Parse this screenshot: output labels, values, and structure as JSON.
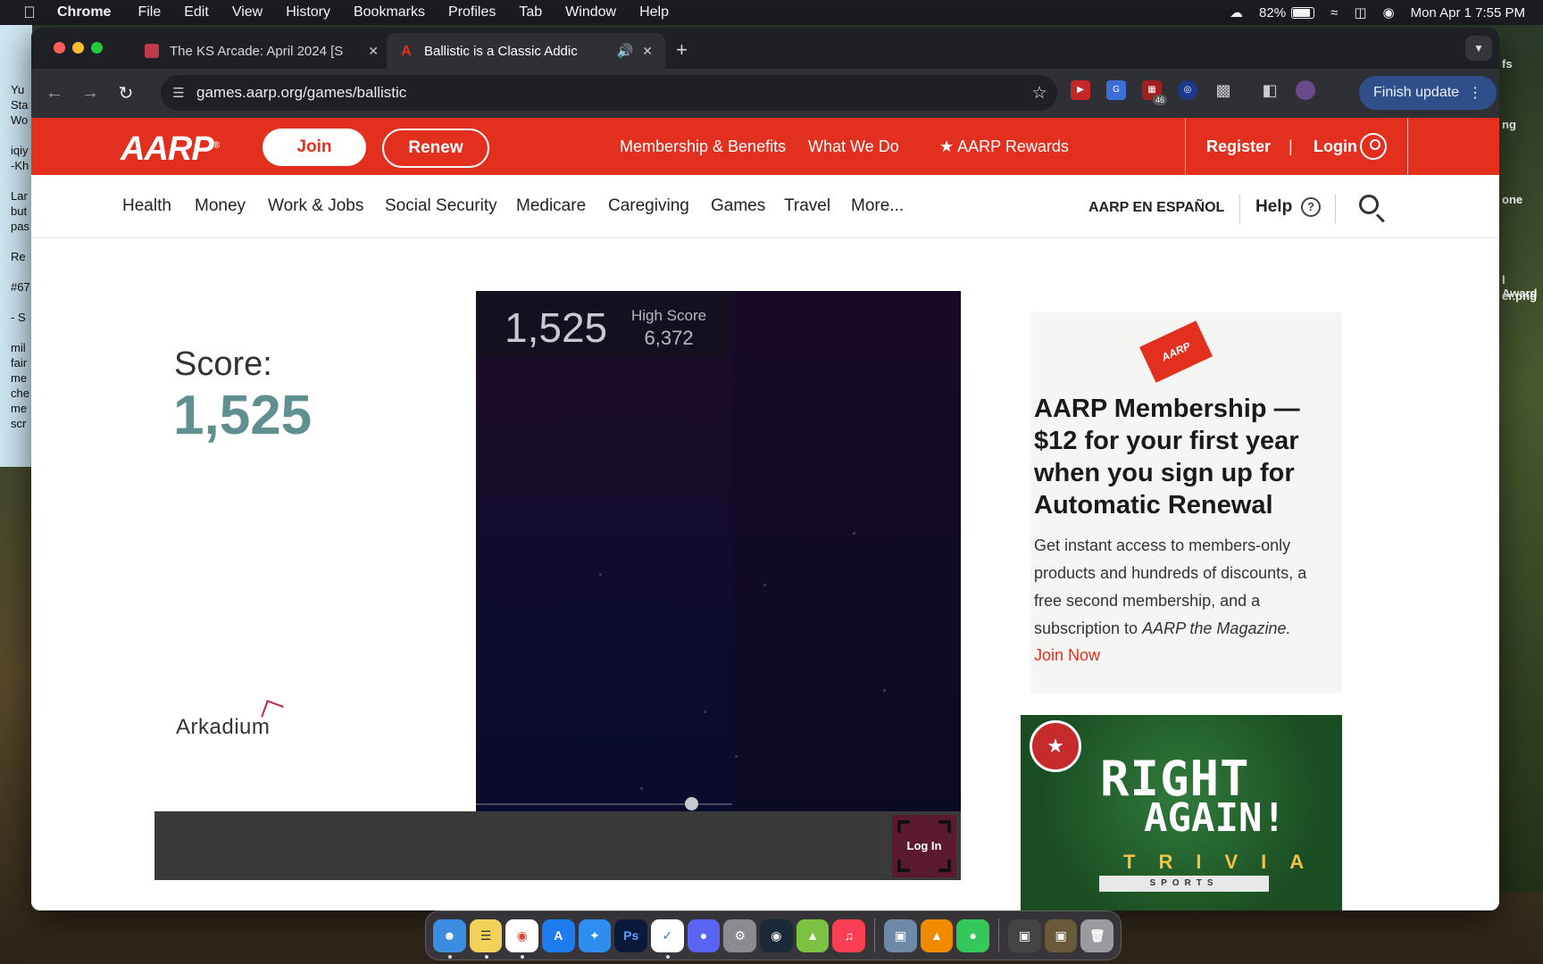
{
  "menubar": {
    "app": "Chrome",
    "items": [
      "File",
      "Edit",
      "View",
      "History",
      "Bookmarks",
      "Profiles",
      "Tab",
      "Window",
      "Help"
    ],
    "battery": "82%",
    "datetime": "Mon Apr 1  7:55 PM"
  },
  "desktop": {
    "left_text": "Yu\nSta\nWo\n\niqiy\n-Kh\n\nLar\nbut\npas\n\nRe\n\n#67\n\n- S\n\nmil\nfair\nme\nche\nme\nscr",
    "right_labels": [
      "fs",
      "ng",
      "one",
      "l Award",
      "er.png"
    ]
  },
  "tabs": [
    {
      "title": "The KS Arcade: April 2024 [S",
      "active": false
    },
    {
      "title": "Ballistic is a Classic Addic",
      "active": true
    }
  ],
  "toolbar": {
    "url": "games.aarp.org/games/ballistic",
    "ext_badge": "46",
    "finish_update": "Finish update"
  },
  "header": {
    "logo": "AARP",
    "join": "Join",
    "renew": "Renew",
    "links": [
      "Membership & Benefits",
      "What We Do",
      "AARP Rewards"
    ],
    "register": "Register",
    "login": "Login"
  },
  "nav": {
    "items": [
      "Health",
      "Money",
      "Work & Jobs",
      "Social Security",
      "Medicare",
      "Caregiving",
      "Games",
      "Travel",
      "More..."
    ],
    "espanol": "AARP EN ESPAÑOL",
    "help": "Help"
  },
  "game": {
    "score_label": "Score:",
    "score": "1,525",
    "hud_score": "1,525",
    "high_score_label": "High Score",
    "high_score": "6,372",
    "brand": "Arkadium",
    "login_button": "Log In"
  },
  "ad": {
    "title": "AARP Membership — $12 for your first year when you sign up for Automatic Renewal",
    "text_prefix": "Get instant access to members-only products and hundreds of discounts, a free second membership, and a subscription to ",
    "text_em": "AARP the Magazine.",
    "link": "Join Now",
    "card_label": "AARP"
  },
  "trivia_ad": {
    "line1": "RIGHT",
    "line2": "AGAIN!",
    "line3": "TRIVIA",
    "line4": "SPORTS"
  },
  "dock": [
    "Finder",
    "Notes",
    "Chrome",
    "App Store",
    "Safari",
    "Ps",
    "Mail",
    "Discord",
    "Settings",
    "Steam",
    "Drive",
    "Music",
    "Preview",
    "VLC",
    "Messages",
    "Screenshot",
    "Photos",
    "Trash"
  ]
}
